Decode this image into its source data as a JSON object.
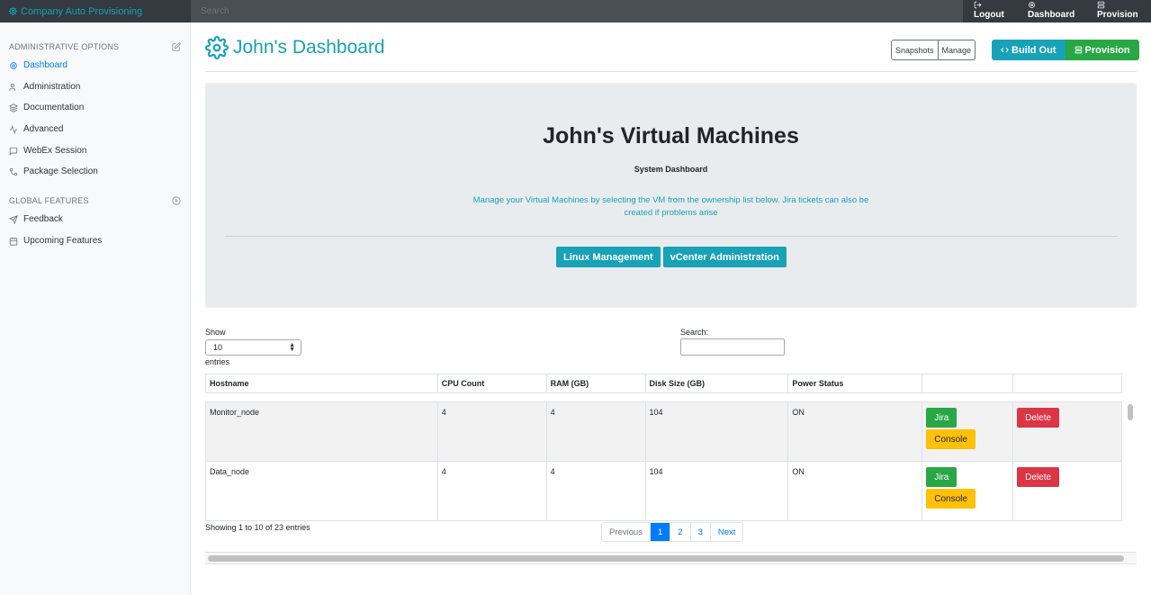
{
  "brand": {
    "title": "Company Auto Provisioning",
    "icon": "gear-icon"
  },
  "top_search": {
    "placeholder": "Search"
  },
  "top_nav": [
    {
      "label": "Logout",
      "icon": "logout-icon"
    },
    {
      "label": "Dashboard",
      "icon": "gear-icon"
    },
    {
      "label": "Provision",
      "icon": "server-icon"
    }
  ],
  "sidebar": {
    "admin_heading": "ADMINISTRATIVE OPTIONS",
    "admin_items": [
      {
        "label": "Dashboard",
        "icon": "gear-icon",
        "active": true
      },
      {
        "label": "Administration",
        "icon": "users-icon"
      },
      {
        "label": "Documentation",
        "icon": "layers-icon"
      },
      {
        "label": "Advanced",
        "icon": "activity-icon"
      },
      {
        "label": "WebEx Session",
        "icon": "message-icon"
      },
      {
        "label": "Package Selection",
        "icon": "git-icon"
      }
    ],
    "global_heading": "GLOBAL FEATURES",
    "global_items": [
      {
        "label": "Feedback",
        "icon": "send-icon"
      },
      {
        "label": "Upcoming Features",
        "icon": "calendar-icon"
      }
    ]
  },
  "header": {
    "title": "John's Dashboard",
    "snapshots_label": "Snapshots",
    "manage_label": "Manage",
    "buildout_label": "Build Out",
    "provision_label": "Provision"
  },
  "jumbotron": {
    "title": "John's Virtual Machines",
    "subtitle": "System Dashboard",
    "lead": "Manage your Virtual Machines by selecting the VM from the ownership list below. Jira tickets can also be created if problems arise",
    "linux_button": "Linux Management",
    "vcenter_button": "vCenter Administration"
  },
  "table_controls": {
    "show_label": "Show",
    "length_value": "10",
    "entries_label": "entries",
    "search_label": "Search:"
  },
  "table": {
    "columns": [
      "Hostname",
      "CPU Count",
      "RAM (GB)",
      "Disk Size (GB)",
      "Power Status",
      "",
      ""
    ],
    "rows": [
      {
        "hostname": "Monitor_node",
        "cpu": "4",
        "ram": "4",
        "disk": "104",
        "power": "ON",
        "jira": "Jira",
        "console": "Console",
        "delete": "Delete"
      },
      {
        "hostname": "Data_node",
        "cpu": "4",
        "ram": "4",
        "disk": "104",
        "power": "ON",
        "jira": "Jira",
        "console": "Console",
        "delete": "Delete"
      }
    ]
  },
  "footer": {
    "info": "Showing 1 to 10 of 23 entries",
    "previous": "Previous",
    "pages": [
      "1",
      "2",
      "3"
    ],
    "next": "Next"
  },
  "colors": {
    "accent": "#17a2b8",
    "success": "#28a745",
    "danger": "#dc3545",
    "warning": "#ffc107",
    "primary": "#007bff"
  }
}
